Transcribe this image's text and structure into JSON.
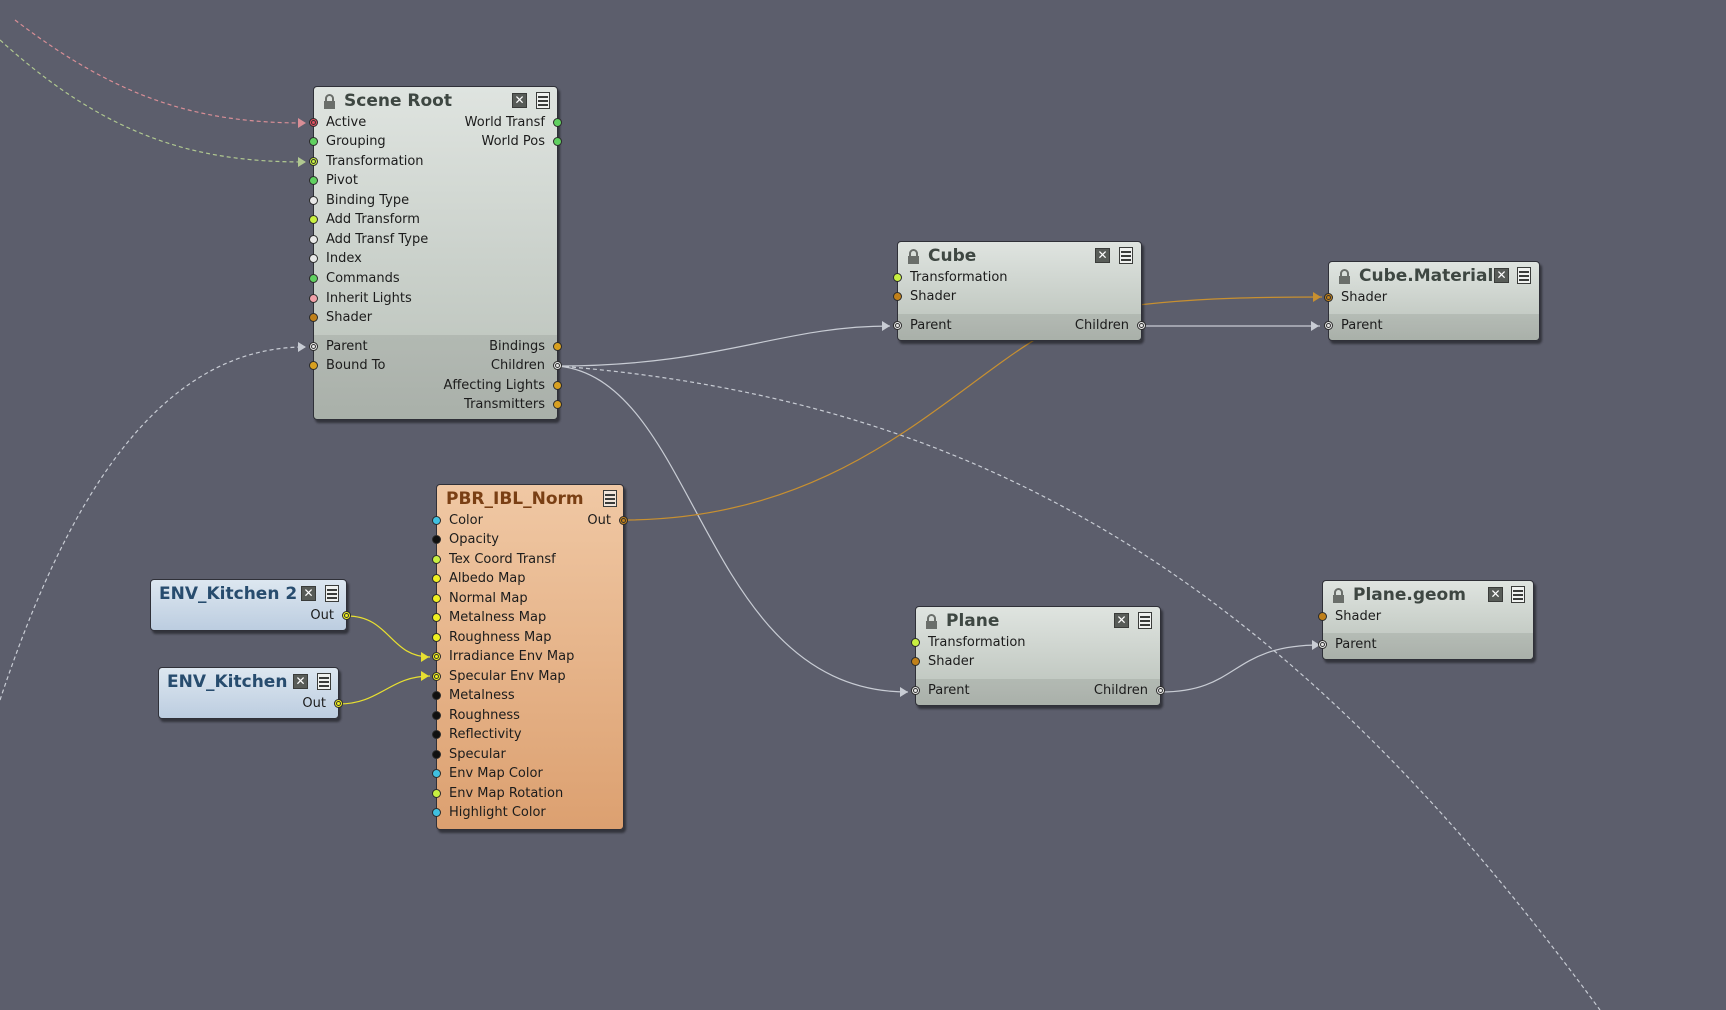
{
  "colors": {
    "background": "#5c5e6c",
    "port_red": "#e05060",
    "port_pink": "#f0a0a8",
    "port_green": "#60d060",
    "port_lime": "#c8f040",
    "port_white": "#e8e8e8",
    "port_orange": "#d8a020",
    "port_brown": "#c0801a",
    "port_yellow": "#f0f020",
    "port_cyan": "#40c0e0",
    "port_black": "#101010",
    "wire_grey": "#c8ccd4",
    "wire_orange": "#c89030",
    "wire_yellow": "#e8e030"
  },
  "nodes": {
    "scene_root": {
      "title": "Scene Root",
      "icons": [
        "lock-icon",
        "close-icon",
        "menu-icon"
      ],
      "inputs": [
        "Active",
        "Grouping",
        "Transformation",
        "Pivot",
        "Binding Type",
        "Add Transform",
        "Add Transf Type",
        "Index",
        "Commands",
        "Inherit Lights",
        "Shader"
      ],
      "outputs": [
        "World Transf",
        "World Pos"
      ],
      "hier_inputs": [
        "Parent",
        "Bound To"
      ],
      "hier_outputs": [
        "Bindings",
        "Children",
        "Affecting Lights",
        "Transmitters"
      ]
    },
    "cube": {
      "title": "Cube",
      "inputs": [
        "Transformation",
        "Shader"
      ],
      "hier_inputs": [
        "Parent"
      ],
      "hier_outputs": [
        "Children"
      ]
    },
    "cube_material": {
      "title": "Cube.Material",
      "inputs": [
        "Shader"
      ],
      "hier_inputs": [
        "Parent"
      ]
    },
    "pbr": {
      "title": "PBR_IBL_Norm",
      "inputs": [
        "Color",
        "Opacity",
        "Tex Coord Transf",
        "Albedo Map",
        "Normal Map",
        "Metalness Map",
        "Roughness Map",
        "Irradiance Env Map",
        "Specular Env Map",
        "Metalness",
        "Roughness",
        "Reflectivity",
        "Specular",
        "Env Map Color",
        "Env Map Rotation",
        "Highlight Color"
      ],
      "outputs": [
        "Out"
      ]
    },
    "env_kitchen_2": {
      "title": "ENV_Kitchen 2",
      "outputs": [
        "Out"
      ]
    },
    "env_kitchen": {
      "title": "ENV_Kitchen",
      "outputs": [
        "Out"
      ]
    },
    "plane": {
      "title": "Plane",
      "inputs": [
        "Transformation",
        "Shader"
      ],
      "hier_inputs": [
        "Parent"
      ],
      "hier_outputs": [
        "Children"
      ]
    },
    "plane_geom": {
      "title": "Plane.geom",
      "inputs": [
        "Shader"
      ],
      "hier_inputs": [
        "Parent"
      ]
    }
  }
}
